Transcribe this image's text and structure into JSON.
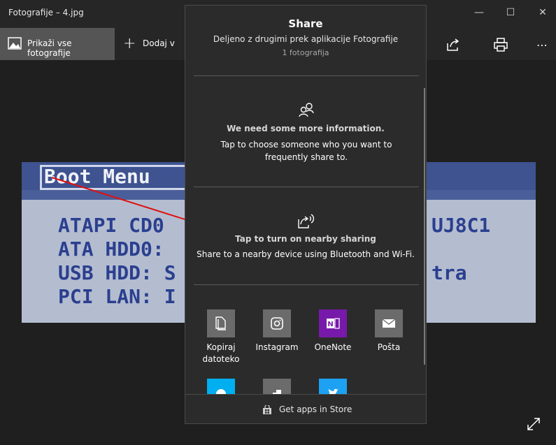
{
  "window": {
    "title": "Fotografije – 4.jpg"
  },
  "toolbar": {
    "show_all": "Prikaži vse fotografije",
    "add": "Dodaj v"
  },
  "photo": {
    "lines": [
      "Boot Menu",
      "ATAPI CD0",
      "ATA HDD0:",
      "USB HDD: S",
      "PCI LAN: I",
      "UJ8C1",
      "tra"
    ]
  },
  "share": {
    "title": "Share",
    "subtitle": "Deljeno z drugimi prek aplikacije Fotografije",
    "count": "1 fotografija",
    "people": {
      "heading": "We need some more information.",
      "desc": "Tap to choose someone who you want to frequently share to."
    },
    "nearby": {
      "heading": "Tap to turn on nearby sharing",
      "desc": "Share to a nearby device using Bluetooth and Wi-Fi."
    },
    "apps": [
      {
        "label": "Kopiraj datoteko",
        "icon": "copy-icon",
        "color": "#6b6b6b"
      },
      {
        "label": "Instagram",
        "icon": "instagram-icon",
        "color": "#6b6b6b"
      },
      {
        "label": "OneNote",
        "icon": "onenote-icon",
        "color": "#7719aa"
      },
      {
        "label": "Pošta",
        "icon": "mail-icon",
        "color": "#6b6b6b"
      }
    ],
    "apps_row2": [
      {
        "icon": "skype-icon",
        "color": "#00aff0"
      },
      {
        "icon": "feedback-icon",
        "color": "#6b6b6b"
      },
      {
        "icon": "twitter-icon",
        "color": "#1da1f2"
      }
    ],
    "store": "Get apps in Store"
  }
}
